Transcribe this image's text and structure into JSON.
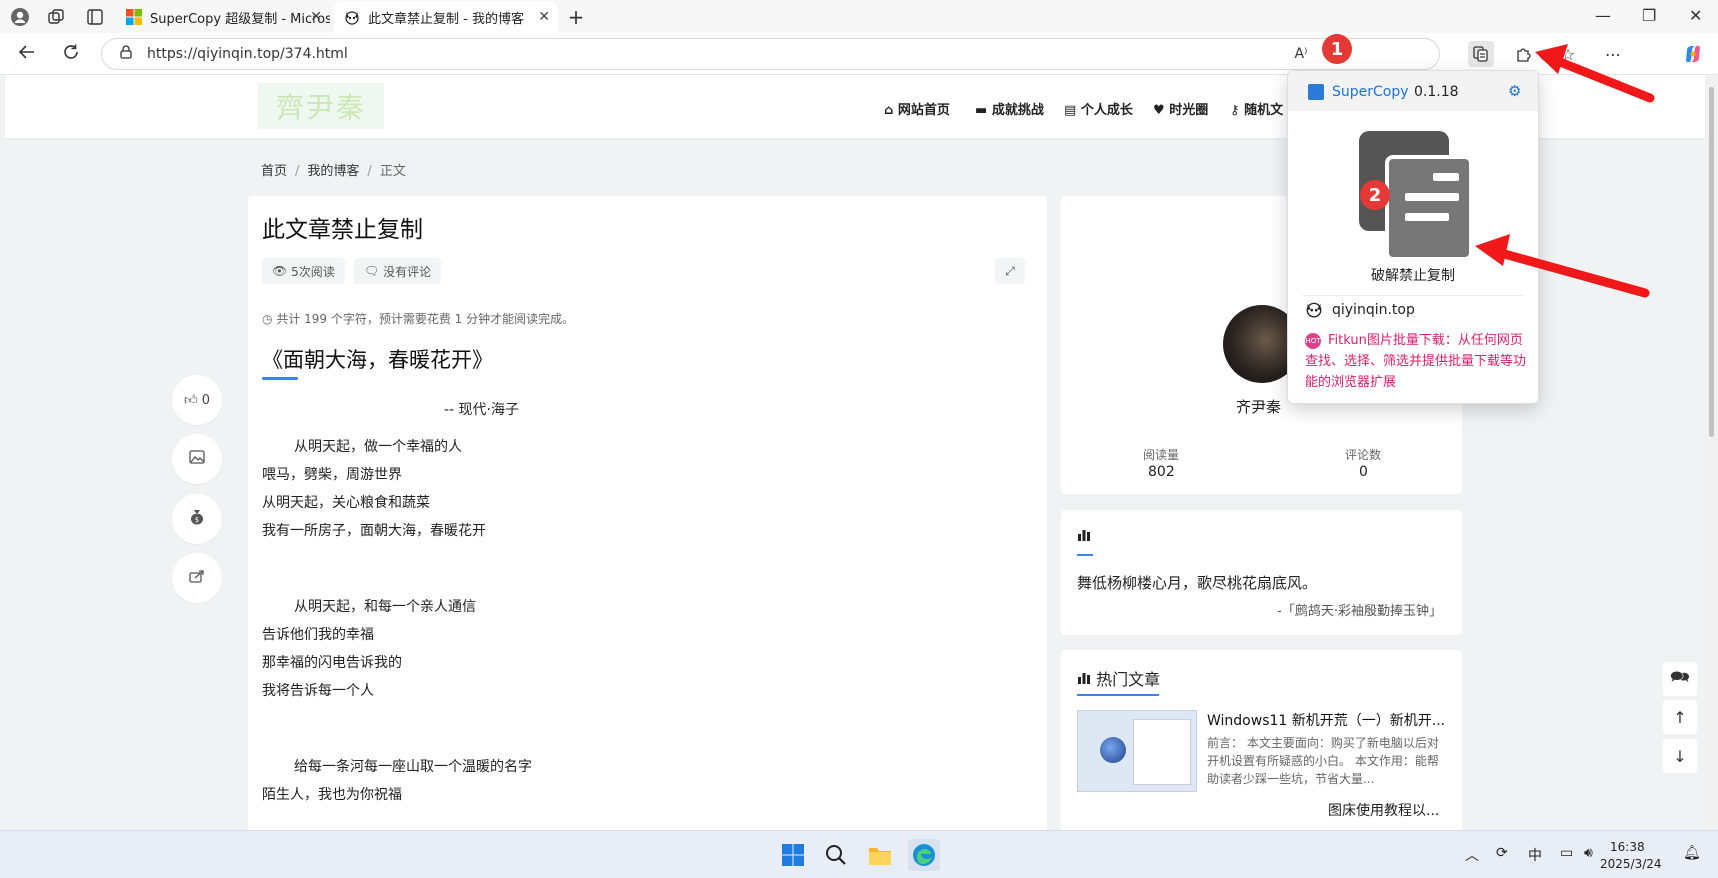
{
  "browser": {
    "tabs": [
      {
        "label": "SuperCopy 超级复制 - Microsoft E",
        "active": false
      },
      {
        "label": "此文章禁止复制 - 我的博客",
        "active": true
      }
    ],
    "new_tab_label": "+",
    "url": "https://qiyinqin.top/374.html",
    "window_controls": {
      "minimize": "—",
      "maximize": "❐",
      "close": "✕"
    }
  },
  "site": {
    "logo_text": "齊尹秦",
    "menu": [
      {
        "icon": "home-icon",
        "label": "网站首页"
      },
      {
        "icon": "folder-icon",
        "label": "成就挑战"
      },
      {
        "icon": "book-icon",
        "label": "个人成长"
      },
      {
        "icon": "heart-icon",
        "label": "时光圈"
      },
      {
        "icon": "key-icon",
        "label": "随机文"
      }
    ],
    "breadcrumb": [
      "首页",
      "我的博客",
      "正文"
    ]
  },
  "article": {
    "title": "此文章禁止复制",
    "views": "5次阅读",
    "comments": "没有评论",
    "word_count": "共计 199 个字符，预计需要花费 1 分钟才能阅读完成。",
    "poem_title": "《面朝大海，春暖花开》",
    "poem_author": "--   现代·海子",
    "lines": [
      "从明天起，做一个幸福的人",
      "喂马，劈柴，周游世界",
      "从明天起，关心粮食和蔬菜",
      "我有一所房子，面朝大海，春暖花开",
      "从明天起，和每一个亲人通信",
      "告诉他们我的幸福",
      "那幸福的闪电告诉我的",
      "我将告诉每一个人",
      "给每一条河每一座山取一个温暖的名字",
      "陌生人，我也为你祝福"
    ],
    "like_count": "0"
  },
  "sidebar": {
    "author_name": "齐尹秦",
    "stats": [
      {
        "label": "阅读量",
        "value": "802"
      },
      {
        "label": "评论数",
        "value": "0"
      }
    ],
    "quote": "舞低杨柳楼心月，歌尽桃花扇底风。",
    "quote_source": "-「鹧鸪天·彩袖殷勤捧玉钟」",
    "hot_title": "热门文章",
    "hot_items": [
      {
        "title": "Windows11 新机开荒（一）新机开...",
        "excerpt": "前言： 本文主要面向：购买了新电脑以后对开机设置有所疑惑的小白。 本文作用：能帮助读者少踩一些坑，节省大量..."
      },
      {
        "title": "图床使用教程以..."
      }
    ]
  },
  "popup": {
    "name": "SuperCopy",
    "version": "0.1.18",
    "action": "破解禁止复制",
    "site": "qiyinqin.top",
    "hot_badge": "HOT",
    "promo": "Fitkun图片批量下载：从任何网页查找、选择、筛选并提供批量下载等功能的浏览器扩展"
  },
  "callouts": [
    "1",
    "2"
  ],
  "taskbar": {
    "ime": "中",
    "time": "16:38",
    "date": "2025/3/24"
  },
  "colors": {
    "accent": "#3b82f6",
    "popup_link": "#1a72d8",
    "promo": "#d6216e",
    "callout": "#e53935"
  }
}
